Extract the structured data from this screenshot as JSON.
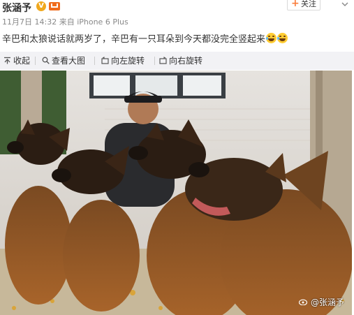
{
  "post": {
    "author": "张涵予",
    "verified_badge": "V",
    "timestamp": "11月7日 14:32",
    "source": "来自 iPhone 6 Plus",
    "follow_label": "关注",
    "text": "辛巴和太狼说话就两岁了，辛巴有一只耳朵到今天都没完全竖起来"
  },
  "toolbar": {
    "collapse_label": "收起",
    "view_large_label": "查看大图",
    "rotate_left_label": "向左旋转",
    "rotate_right_label": "向右旋转"
  },
  "photo": {
    "watermark": "@张涵予"
  },
  "colors": {
    "accent_orange": "#fa7d3c",
    "verified_gold": "#f0a81e",
    "toolbar_bg": "#f2f2f5"
  },
  "icons": [
    "verified-badge-icon",
    "member-crown-icon",
    "plus-icon",
    "chevron-down-icon",
    "collapse-up-icon",
    "magnify-icon",
    "rotate-left-icon",
    "rotate-right-icon",
    "laughing-tears-emoji",
    "weibo-logo-icon"
  ]
}
